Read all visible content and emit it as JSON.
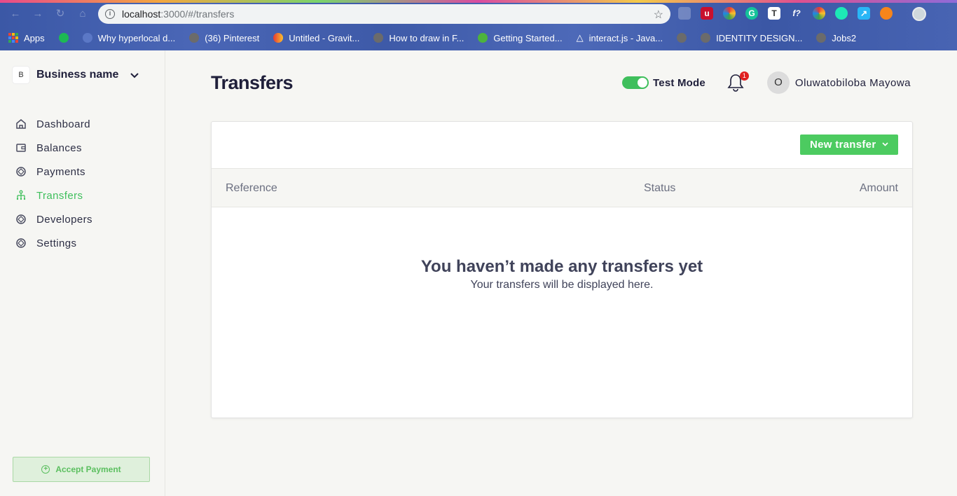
{
  "browser": {
    "url_host": "localhost",
    "url_path": ":3000/#/transfers",
    "bookmarks": [
      {
        "label": "Apps",
        "icon": "apps-grid-icon"
      },
      {
        "label": "",
        "icon": "spotify-icon"
      },
      {
        "label": "Why hyperlocal d...",
        "icon": "globe-icon"
      },
      {
        "label": "(36) Pinterest",
        "icon": "pinterest-icon"
      },
      {
        "label": "Untitled - Gravit...",
        "icon": "gravit-icon"
      },
      {
        "label": "How to draw in F...",
        "icon": "globe-icon"
      },
      {
        "label": "Getting Started...",
        "icon": "mongodb-icon"
      },
      {
        "label": "interact.js - Java...",
        "icon": "triangle-icon"
      },
      {
        "label": "",
        "icon": "globe-icon"
      },
      {
        "label": "IDENTITY DESIGN...",
        "icon": "globe-icon"
      },
      {
        "label": "Jobs2",
        "icon": "globe-icon"
      }
    ]
  },
  "sidebar": {
    "business_initial": "B",
    "business_name": "Business name",
    "items": [
      {
        "label": "Dashboard",
        "icon": "home-icon",
        "active": false
      },
      {
        "label": "Balances",
        "icon": "wallet-icon",
        "active": false
      },
      {
        "label": "Payments",
        "icon": "payments-icon",
        "active": false
      },
      {
        "label": "Transfers",
        "icon": "transfers-icon",
        "active": true
      },
      {
        "label": "Developers",
        "icon": "developers-icon",
        "active": false
      },
      {
        "label": "Settings",
        "icon": "settings-icon",
        "active": false
      }
    ],
    "accept_payment": "Accept Payment"
  },
  "header": {
    "title": "Transfers",
    "test_mode_label": "Test Mode",
    "test_mode_on": true,
    "notification_count": "1",
    "user_initial": "O",
    "user_name": "Oluwatobiloba Mayowa"
  },
  "transfers": {
    "new_transfer_label": "New transfer",
    "columns": [
      "Reference",
      "Status",
      "Amount"
    ],
    "empty_title": "You haven’t made any transfers yet",
    "empty_subtitle": "Your transfers will be displayed here."
  },
  "colors": {
    "accent_green": "#4ccb60",
    "text_dark": "#1f1f3a",
    "badge_red": "#e02020"
  }
}
